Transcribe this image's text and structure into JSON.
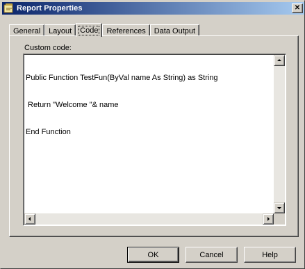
{
  "window": {
    "title": "Report Properties",
    "close_symbol": "✕",
    "icon": "report-properties-icon"
  },
  "tabs": [
    {
      "label": "General",
      "active": false
    },
    {
      "label": "Layout",
      "active": false
    },
    {
      "label": "Code",
      "active": true
    },
    {
      "label": "References",
      "active": false
    },
    {
      "label": "Data Output",
      "active": false
    }
  ],
  "panel": {
    "custom_code_label": "Custom code:",
    "code_lines": [
      "Public Function TestFun(ByVal name As String) as String",
      " Return \"Welcome \"& name",
      "End Function"
    ]
  },
  "buttons": {
    "ok": "OK",
    "cancel": "Cancel",
    "help": "Help"
  }
}
